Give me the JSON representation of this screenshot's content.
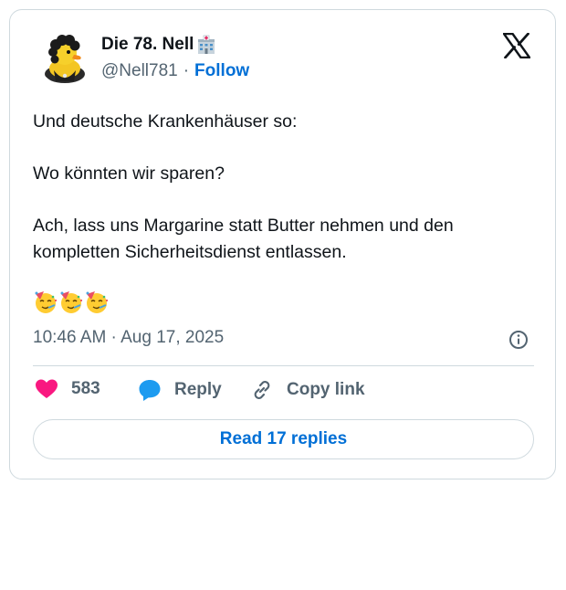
{
  "author": {
    "display_name": "Die 78. Nell",
    "handle": "@Nell781",
    "separator": "·",
    "follow_label": "Follow",
    "avatar_icon": "rubber-duck-avatar",
    "name_badge_icon": "hospital-emoji"
  },
  "tweet": {
    "lines": [
      "Und deutsche Krankenhäuser so:",
      "",
      "Wo könnten wir sparen?",
      "",
      "Ach, lass uns Margarine statt Butter nehmen und den",
      "kompletten Sicherheitsdienst entlassen.",
      ""
    ],
    "emojis": [
      "partying-face-emoji",
      "partying-face-emoji",
      "partying-face-emoji"
    ],
    "timestamp": "10:46 AM · Aug 17, 2025"
  },
  "actions": {
    "like_count": "583",
    "reply_label": "Reply",
    "copy_link_label": "Copy link"
  },
  "footer": {
    "read_replies_label": "Read 17 replies"
  },
  "colors": {
    "accent": "#006fd6",
    "like": "#f91880",
    "reply": "#1d9bf0",
    "border": "#cfd9de",
    "muted": "#536471",
    "text": "#0f1419"
  }
}
